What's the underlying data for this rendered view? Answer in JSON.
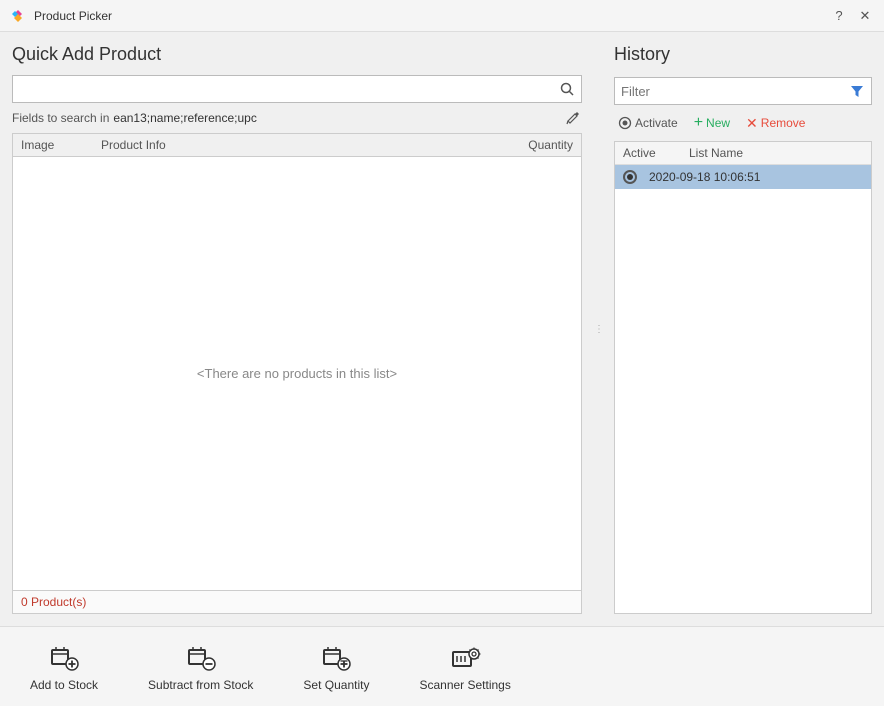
{
  "titlebar": {
    "title": "Product Picker",
    "help_tooltip": "?",
    "close_label": "✕"
  },
  "left": {
    "section_title": "Quick Add Product",
    "search": {
      "placeholder": "",
      "cursor_visible": true
    },
    "fields_label": "Fields to search in",
    "fields_value": "ean13;name;reference;upc",
    "table": {
      "col_image": "Image",
      "col_info": "Product Info",
      "col_qty": "Quantity",
      "empty_message": "<There are no products in this list>",
      "footer": "0 Product(s)"
    }
  },
  "right": {
    "history_title": "History",
    "filter_placeholder": "Filter",
    "toolbar": {
      "activate_label": "Activate",
      "new_label": "New",
      "remove_label": "Remove"
    },
    "list": {
      "col_active": "Active",
      "col_name": "List Name",
      "items": [
        {
          "active": true,
          "name": "2020-09-18 10:06:51"
        }
      ]
    }
  },
  "bottom_toolbar": {
    "add_to_stock": "Add to Stock",
    "subtract_from_stock": "Subtract from Stock",
    "set_quantity": "Set Quantity",
    "scanner_settings": "Scanner Settings"
  },
  "colors": {
    "accent_blue": "#3a7bd5",
    "history_selected_bg": "#a8c4e0",
    "footer_red": "#c0392b",
    "new_green": "#27ae60",
    "remove_red": "#e74c3c"
  }
}
